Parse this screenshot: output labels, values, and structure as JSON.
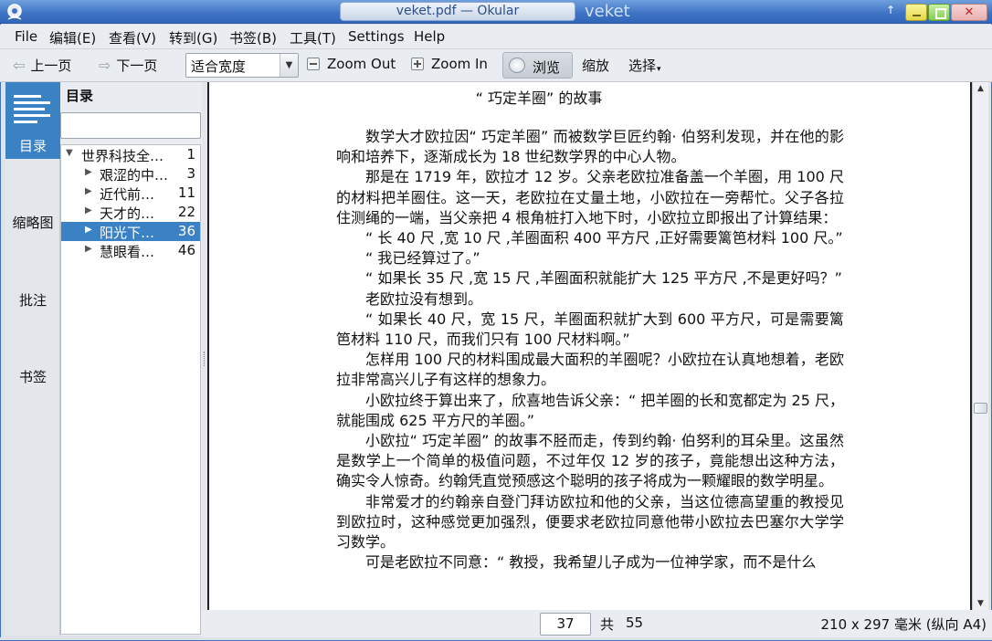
{
  "window": {
    "title": "veket.pdf  —  Okular",
    "ghost_title": "veket",
    "up_arrow": "↑",
    "close_glyph": "✕"
  },
  "menu": [
    "File",
    "编辑(E)",
    "查看(V)",
    "转到(G)",
    "书签(B)",
    "工具(T)",
    "Settings",
    "Help"
  ],
  "toolbar": {
    "prev_page": "上一页",
    "next_page": "下一页",
    "zoom_mode": "适合宽度",
    "zoom_out": "Zoom Out",
    "zoom_in": "Zoom In",
    "browse": "浏览",
    "zoom_tool": "缩放",
    "select_tool": "选择"
  },
  "sidebar_tabs": [
    "目录",
    "缩略图",
    "批注",
    "书签"
  ],
  "toc": {
    "title": "目录",
    "search_placeholder": "",
    "items": [
      {
        "label": "世界科技全…",
        "page": "1",
        "level": 0,
        "expanded": true
      },
      {
        "label": "艰涩的中…",
        "page": "3",
        "level": 1
      },
      {
        "label": "近代前…",
        "page": "11",
        "level": 1
      },
      {
        "label": "天才的…",
        "page": "22",
        "level": 1
      },
      {
        "label": "阳光下…",
        "page": "36",
        "level": 1,
        "selected": true
      },
      {
        "label": "慧眼看…",
        "page": "46",
        "level": 1
      }
    ]
  },
  "document": {
    "title": "“  巧定羊圈”  的故事",
    "paragraphs": [
      "数学大才欧拉因“  巧定羊圈”  而被数学巨匠约翰·  伯努利发现，并在他的影响和培养下，逐渐成长为 18 世纪数学界的中心人物。",
      "那是在 1719 年，欧拉才 12 岁。父亲老欧拉准备盖一个羊圈，用 100 尺的材料把羊圈住。这一天，老欧拉在丈量土地，小欧拉在一旁帮忙。父子各拉住测绳的一端，当父亲把 4 根角桩打入地下时，小欧拉立即报出了计算结果：",
      "“  长 40 尺 ,宽 10 尺 ,羊圈面积 400 平方尺 ,正好需要篱笆材料 100 尺。”",
      "“  我已经算过了。”",
      "“  如果长 35 尺 ,宽 15 尺 ,羊圈面积就能扩大 125 平方尺 ,不是更好吗？”",
      "老欧拉没有想到。",
      "“  如果长 40 尺，宽 15 尺，羊圈面积就扩大到 600 平方尺，可是需要篱笆材料 110 尺，而我们只有 100 尺材料啊。”",
      "怎样用 100 尺的材料围成最大面积的羊圈呢？小欧拉在认真地想着，老欧拉非常高兴儿子有这样的想象力。",
      "小欧拉终于算出来了，欣喜地告诉父亲：“  把羊圈的长和宽都定为  25 尺，就能围成 625 平方尺的羊圈。”",
      "小欧拉“  巧定羊圈”  的故事不胫而走，传到约翰·  伯努利的耳朵里。这虽然是数学上一个简单的极值问题，不过年仅 12 岁的孩子，竟能想出这种方法，确实令人惊奇。约翰凭直觉预感这个聪明的孩子将成为一颗耀眼的数学明星。",
      "非常爱才的约翰亲自登门拜访欧拉和他的父亲，当这位德高望重的教授见到欧拉时，这种感觉更加强烈，便要求老欧拉同意他带小欧拉去巴塞尔大学学习数学。",
      "可是老欧拉不同意：“  教授，我希望儿子成为一位神学家，而不是什么"
    ]
  },
  "status": {
    "current_page": "37",
    "of_label": "共",
    "total_pages": "55",
    "page_size": "210 x 297 毫米 (纵向 A4)"
  }
}
